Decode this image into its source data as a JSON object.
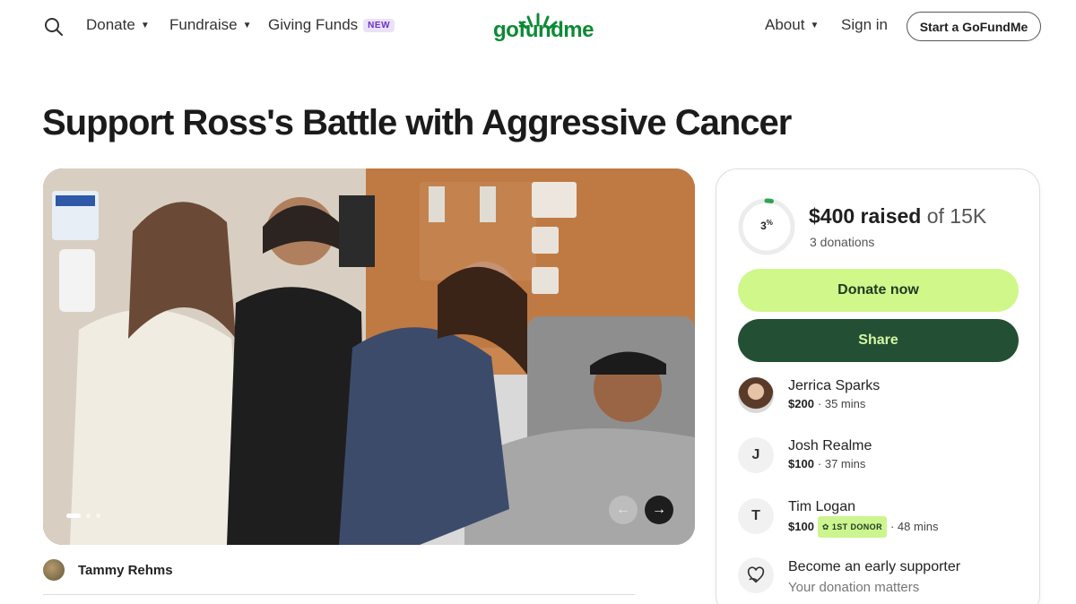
{
  "header": {
    "nav_left": [
      {
        "label": "Donate",
        "caret": true
      },
      {
        "label": "Fundraise",
        "caret": true
      },
      {
        "label": "Giving Funds",
        "badge": "NEW"
      }
    ],
    "logo": "gofundme",
    "nav_right": [
      {
        "label": "About",
        "caret": true
      },
      {
        "label": "Sign in"
      }
    ],
    "cta": "Start a GoFundMe"
  },
  "campaign": {
    "title": "Support Ross's Battle with Aggressive Cancer",
    "organizer": "Tammy Rehms",
    "carousel_slide": 1,
    "carousel_total": 3
  },
  "panel": {
    "progress_percent": "3",
    "progress_fraction": 0.03,
    "raised": "$400 raised",
    "goal": "of 15K",
    "donations": "3 donations",
    "donate_label": "Donate now",
    "share_label": "Share",
    "donors": [
      {
        "name": "Jerrica Sparks",
        "amount": "$200",
        "time": "· 35 mins",
        "initial": ""
      },
      {
        "name": "Josh Realme",
        "amount": "$100",
        "time": "· 37 mins",
        "initial": "J"
      },
      {
        "name": "Tim Logan",
        "amount": "$100",
        "badge": "1ST DONOR",
        "time": "· 48 mins",
        "initial": "T"
      }
    ],
    "early_title": "Become an early supporter",
    "early_sub": "Your donation matters"
  },
  "colors": {
    "brand_green": "#0c8a35",
    "donate_bg": "#d0f78a",
    "share_bg": "#234f35",
    "badge_new_bg": "#ebe1fb"
  }
}
